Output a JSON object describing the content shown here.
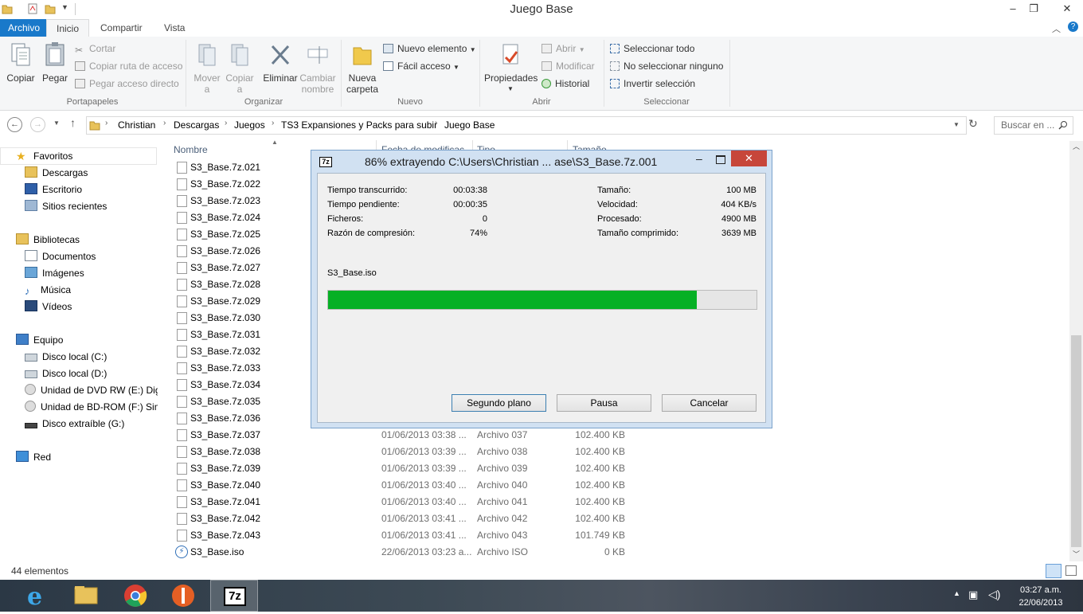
{
  "window": {
    "title": "Juego Base",
    "minimize": "–",
    "maximize": "❐",
    "close": "✕"
  },
  "ribbon": {
    "tabs": [
      "Archivo",
      "Inicio",
      "Compartir",
      "Vista"
    ],
    "portapapeles": {
      "label": "Portapapeles",
      "copiar": "Copiar",
      "pegar": "Pegar",
      "cortar": "Cortar",
      "copiar_ruta": "Copiar ruta de acceso",
      "pegar_acceso": "Pegar acceso directo"
    },
    "organizar": {
      "label": "Organizar",
      "mover_1": "Mover",
      "mover_2": "a",
      "copiar_1": "Copiar",
      "copiar_2": "a",
      "eliminar": "Eliminar",
      "cambiar_1": "Cambiar",
      "cambiar_2": "nombre"
    },
    "nuevo": {
      "label": "Nuevo",
      "nueva_1": "Nueva",
      "nueva_2": "carpeta",
      "nuevo_elemento": "Nuevo elemento",
      "facil_acceso": "Fácil acceso"
    },
    "abrir": {
      "label": "Abrir",
      "propiedades": "Propiedades",
      "abrir": "Abrir",
      "modificar": "Modificar",
      "historial": "Historial"
    },
    "seleccionar": {
      "label": "Seleccionar",
      "todo": "Seleccionar todo",
      "ninguno": "No seleccionar ninguno",
      "invertir": "Invertir selección"
    }
  },
  "address": {
    "crumbs": [
      "Christian",
      "Descargas",
      "Juegos",
      "TS3 Expansiones y Packs para subir",
      "Juego Base"
    ],
    "search_placeholder": "Buscar en ..."
  },
  "nav": {
    "favoritos": "Favoritos",
    "descargas": "Descargas",
    "escritorio": "Escritorio",
    "sitios": "Sitios recientes",
    "bibliotecas": "Bibliotecas",
    "documentos": "Documentos",
    "imagenes": "Imágenes",
    "musica": "Música",
    "videos": "Vídeos",
    "equipo": "Equipo",
    "disco_c": "Disco local (C:)",
    "disco_d": "Disco local (D:)",
    "dvd": "Unidad de DVD RW (E:) Digi",
    "bdrom": "Unidad de BD-ROM (F:) Sim",
    "extraible": "Disco extraíble (G:)",
    "red": "Red"
  },
  "columns": {
    "nombre": "Nombre",
    "fecha": "Fecha de modificac",
    "tipo": "Tipo",
    "tamano": "Tamaño"
  },
  "files": [
    {
      "name": "S3_Base.7z.021",
      "date": "",
      "type": "",
      "size": ""
    },
    {
      "name": "S3_Base.7z.022",
      "date": "",
      "type": "",
      "size": ""
    },
    {
      "name": "S3_Base.7z.023",
      "date": "",
      "type": "",
      "size": ""
    },
    {
      "name": "S3_Base.7z.024",
      "date": "",
      "type": "",
      "size": ""
    },
    {
      "name": "S3_Base.7z.025",
      "date": "",
      "type": "",
      "size": ""
    },
    {
      "name": "S3_Base.7z.026",
      "date": "",
      "type": "",
      "size": ""
    },
    {
      "name": "S3_Base.7z.027",
      "date": "",
      "type": "",
      "size": ""
    },
    {
      "name": "S3_Base.7z.028",
      "date": "",
      "type": "",
      "size": ""
    },
    {
      "name": "S3_Base.7z.029",
      "date": "",
      "type": "",
      "size": ""
    },
    {
      "name": "S3_Base.7z.030",
      "date": "",
      "type": "",
      "size": ""
    },
    {
      "name": "S3_Base.7z.031",
      "date": "",
      "type": "",
      "size": ""
    },
    {
      "name": "S3_Base.7z.032",
      "date": "",
      "type": "",
      "size": ""
    },
    {
      "name": "S3_Base.7z.033",
      "date": "",
      "type": "",
      "size": ""
    },
    {
      "name": "S3_Base.7z.034",
      "date": "",
      "type": "",
      "size": ""
    },
    {
      "name": "S3_Base.7z.035",
      "date": "",
      "type": "",
      "size": ""
    },
    {
      "name": "S3_Base.7z.036",
      "date": "",
      "type": "",
      "size": ""
    },
    {
      "name": "S3_Base.7z.037",
      "date": "01/06/2013 03:38 ...",
      "type": "Archivo 037",
      "size": "102.400 KB"
    },
    {
      "name": "S3_Base.7z.038",
      "date": "01/06/2013 03:39 ...",
      "type": "Archivo 038",
      "size": "102.400 KB"
    },
    {
      "name": "S3_Base.7z.039",
      "date": "01/06/2013 03:39 ...",
      "type": "Archivo 039",
      "size": "102.400 KB"
    },
    {
      "name": "S3_Base.7z.040",
      "date": "01/06/2013 03:40 ...",
      "type": "Archivo 040",
      "size": "102.400 KB"
    },
    {
      "name": "S3_Base.7z.041",
      "date": "01/06/2013 03:40 ...",
      "type": "Archivo 041",
      "size": "102.400 KB"
    },
    {
      "name": "S3_Base.7z.042",
      "date": "01/06/2013 03:41 ...",
      "type": "Archivo 042",
      "size": "102.400 KB"
    },
    {
      "name": "S3_Base.7z.043",
      "date": "01/06/2013 03:41 ...",
      "type": "Archivo 043",
      "size": "101.749 KB"
    },
    {
      "name": "S3_Base.iso",
      "date": "22/06/2013 03:23 a...",
      "type": "Archivo ISO",
      "size": "0 KB"
    }
  ],
  "status": {
    "count": "44 elementos"
  },
  "dialog": {
    "title": "86% extrayendo C:\\Users\\Christian ... ase\\S3_Base.7z.001",
    "icon_text": "7z",
    "labels": {
      "elapsed": "Tiempo transcurrido:",
      "remaining": "Tiempo pendiente:",
      "files": "Ficheros:",
      "ratio": "Razón de compresión:",
      "size": "Tamaño:",
      "speed": "Velocidad:",
      "processed": "Procesado:",
      "compressed": "Tamaño comprimido:"
    },
    "values": {
      "elapsed": "00:03:38",
      "remaining": "00:00:35",
      "files": "0",
      "ratio": "74%",
      "size": "100 MB",
      "speed": "404 KB/s",
      "processed": "4900 MB",
      "compressed": "3639 MB"
    },
    "current_file": "S3_Base.iso",
    "progress": 0.86,
    "buttons": {
      "background": "Segundo plano",
      "pause": "Pausa",
      "cancel": "Cancelar"
    }
  },
  "taskbar": {
    "time": "03:27 a.m.",
    "date": "22/06/2013",
    "app_7z": "7z"
  },
  "colors": {
    "accent": "#1979ca",
    "progress": "#06b025",
    "dialog_frame": "#d1e1f2",
    "close_red": "#c7463a"
  }
}
